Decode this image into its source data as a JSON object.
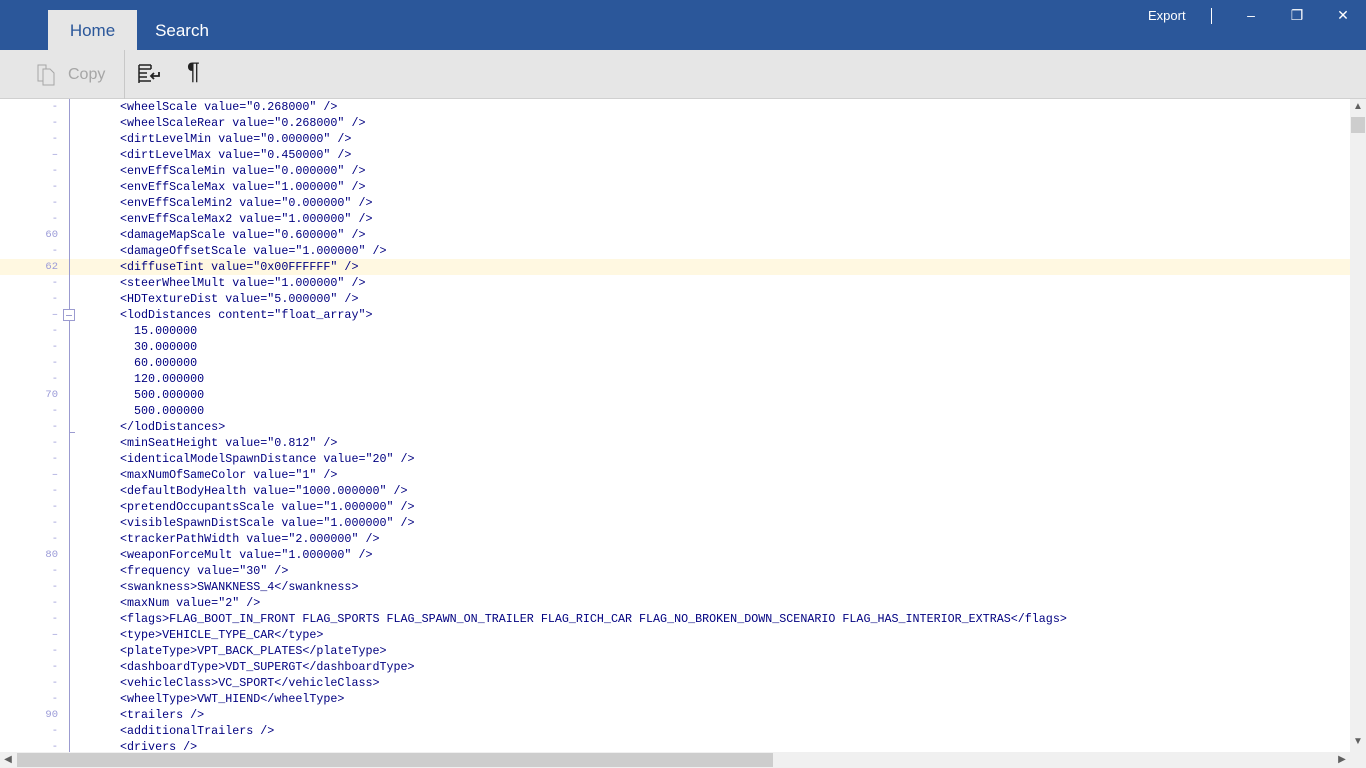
{
  "tabs": [
    {
      "label": "Home",
      "active": true
    },
    {
      "label": "Search",
      "active": false
    }
  ],
  "window": {
    "export_label": "Export",
    "minimize": "–",
    "restore": "❐",
    "close": "✕"
  },
  "ribbon": {
    "copy_label": "Copy",
    "pilcrow": "¶"
  },
  "editor": {
    "first_line": 52,
    "current_line": 62,
    "lines": [
      "<wheelScale value=\"0.268000\" />",
      "<wheelScaleRear value=\"0.268000\" />",
      "<dirtLevelMin value=\"0.000000\" />",
      "<dirtLevelMax value=\"0.450000\" />",
      "<envEffScaleMin value=\"0.000000\" />",
      "<envEffScaleMax value=\"1.000000\" />",
      "<envEffScaleMin2 value=\"0.000000\" />",
      "<envEffScaleMax2 value=\"1.000000\" />",
      "<damageMapScale value=\"0.600000\" />",
      "<damageOffsetScale value=\"1.000000\" />",
      "<diffuseTint value=\"0x00FFFFFF\" />",
      "<steerWheelMult value=\"1.000000\" />",
      "<HDTextureDist value=\"5.000000\" />",
      "<lodDistances content=\"float_array\">",
      "  15.000000",
      "  30.000000",
      "  60.000000",
      "  120.000000",
      "  500.000000",
      "  500.000000",
      "</lodDistances>",
      "<minSeatHeight value=\"0.812\" />",
      "<identicalModelSpawnDistance value=\"20\" />",
      "<maxNumOfSameColor value=\"1\" />",
      "<defaultBodyHealth value=\"1000.000000\" />",
      "<pretendOccupantsScale value=\"1.000000\" />",
      "<visibleSpawnDistScale value=\"1.000000\" />",
      "<trackerPathWidth value=\"2.000000\" />",
      "<weaponForceMult value=\"1.000000\" />",
      "<frequency value=\"30\" />",
      "<swankness>SWANKNESS_4</swankness>",
      "<maxNum value=\"2\" />",
      "<flags>FLAG_BOOT_IN_FRONT FLAG_SPORTS FLAG_SPAWN_ON_TRAILER FLAG_RICH_CAR FLAG_NO_BROKEN_DOWN_SCENARIO FLAG_HAS_INTERIOR_EXTRAS</flags>",
      "<type>VEHICLE_TYPE_CAR</type>",
      "<plateType>VPT_BACK_PLATES</plateType>",
      "<dashboardType>VDT_SUPERGT</dashboardType>",
      "<vehicleClass>VC_SPORT</vehicleClass>",
      "<wheelType>VWT_HIEND</wheelType>",
      "<trailers />",
      "<additionalTrailers />",
      "<drivers />"
    ]
  }
}
